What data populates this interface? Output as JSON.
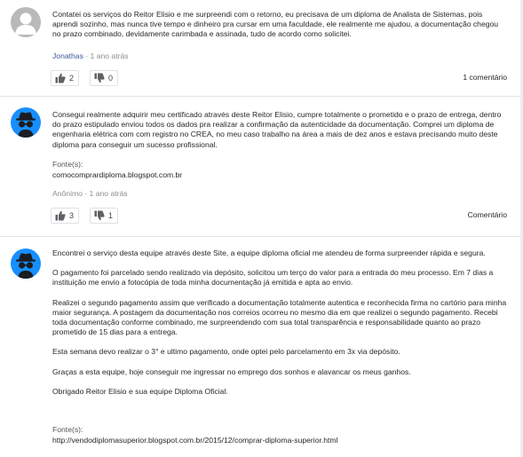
{
  "answers": [
    {
      "paragraphs": [
        "Contatei os serviços do Reitor Elisio e me surpreendi com o retorno, eu precisava de um diploma de Analista de Sistemas, pois aprendi sozinho, mas nunca tive tempo e dinheiro pra cursar em uma faculdade, ele realmente me ajudou, a documentação chegou no prazo combinado, devidamente carimbada e assinada, tudo de acordo como solicitei."
      ],
      "author": "Jonathas",
      "time": "· 1 ano atrás",
      "thumbs_up": "2",
      "thumbs_down": "0",
      "comments": "1 comentário"
    },
    {
      "paragraphs": [
        "Consegui realmente adquirir meu certificado através deste Reitor Elisio, cumpre totalmente o prometido e o prazo de entrega, dentro do prazo estipulado enviou todos os dados pra realizar a confirmação da autenticidade da documentação. Comprei um diploma de engenharia elétrica com com registro no CREA, no meu caso trabalho na área a mais de dez anos e estava precisando muito deste diploma para conseguir um sucesso profissional."
      ],
      "source_label": "Fonte(s):",
      "source_url": "comocomprardiploma.blogspot.com.br",
      "author": "Anônimo",
      "time": "· 1 ano atrás",
      "thumbs_up": "3",
      "thumbs_down": "1",
      "comments": "Comentário"
    },
    {
      "paragraphs": [
        "Encontrei o serviço desta equipe através deste Site, a equipe diploma oficial me atendeu de forma surpreender rápida e segura.",
        "O pagamento foi parcelado sendo realizado via depósito, solicitou um terço do valor para a entrada do meu processo. Em 7 dias a instituição me envio a fotocópia de toda minha documentação já emitida e apta ao envio.",
        "Realizei o segundo pagamento assim que verificado a documentação totalmente autentica e reconhecida firma no cartório para minha maior segurança. A postagem da documentação nos correios ocorreu no mesmo dia em que realizei o segundo pagamento. Recebi toda documentação conforme combinado, me surpreendendo com sua total transparência e responsabilidade quanto ao prazo prometido de 15 dias para a entrega.",
        "Esta semana devo realizar o 3° e ultimo pagamento, onde optei pelo parcelamento em 3x via depósito.",
        "Graças a esta equipe, hoje conseguir me ingressar no emprego dos sonhos e alavancar os meus ganhos.",
        "Obrigado Reitor Elisio e sua equipe Diploma Oficial."
      ],
      "source_label": "Fonte(s):",
      "source_url": "http://vendodiplomasuperior.blogspot.com.br/2015/12/comprar-diploma-superior.html"
    }
  ],
  "colors": {
    "avatar_gray": "#b9b9b9",
    "avatar_blue": "#188fff",
    "author_link": "#3b5998",
    "divider": "#e0e4e9"
  },
  "icons": [
    "default-avatar-icon",
    "anonymous-spy-avatar-icon",
    "thumbs-up-icon",
    "thumbs-down-icon"
  ]
}
